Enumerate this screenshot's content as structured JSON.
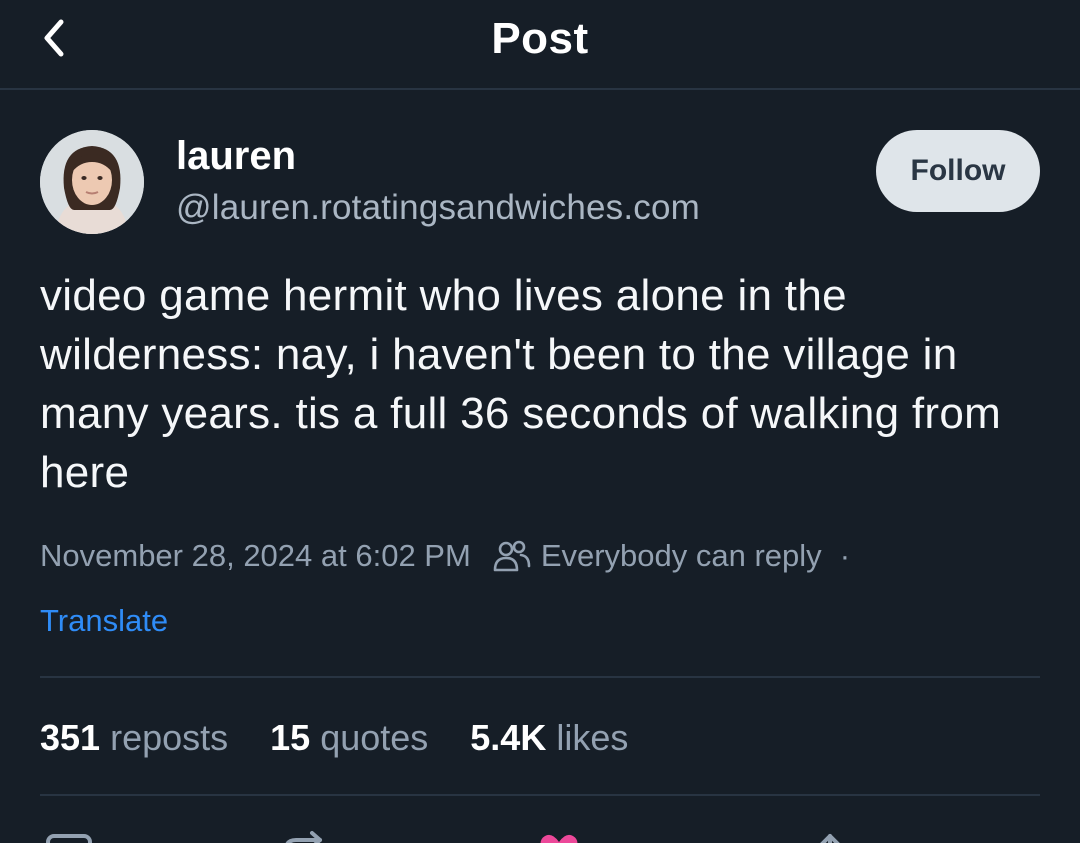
{
  "header": {
    "title": "Post",
    "back_icon": "chevron-left-icon"
  },
  "author": {
    "display_name": "lauren",
    "handle": "@lauren.rotatingsandwiches.com",
    "follow_label": "Follow"
  },
  "post": {
    "text": "video game hermit who lives alone in the wilderness: nay, i haven't been to the village in many years. tis a full 36 seconds of walking from here",
    "timestamp": "November 28, 2024 at 6:02 PM",
    "reply_setting": "Everybody can reply",
    "separator": "·",
    "translate_label": "Translate"
  },
  "stats": {
    "reposts_count": "351",
    "reposts_label": "reposts",
    "quotes_count": "15",
    "quotes_label": "quotes",
    "likes_count": "5.4K",
    "likes_label": "likes"
  },
  "actions": [
    "reply-icon",
    "repost-icon",
    "like-icon",
    "share-icon"
  ],
  "colors": {
    "background": "#161e27",
    "divider": "#283442",
    "muted_text": "#93a1b1",
    "link": "#2f8cf7",
    "follow_bg": "#dfe5ea",
    "like_accent": "#ec4899"
  }
}
